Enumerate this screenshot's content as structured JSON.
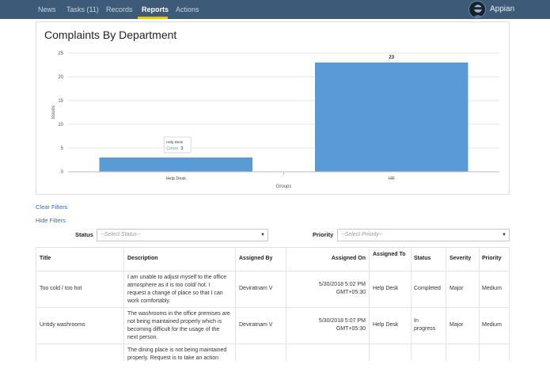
{
  "nav": {
    "items": [
      "News",
      "Tasks (11)",
      "Records",
      "Reports",
      "Actions"
    ],
    "active": "Reports",
    "brand": "Appian",
    "colors": {
      "bar": "#3d5a78",
      "active_underline": "#f0c400"
    }
  },
  "chart_card": {
    "title": "Complaints By Department"
  },
  "chart_data": {
    "type": "bar",
    "categories": [
      "Help Desk",
      "HR"
    ],
    "values": [
      3,
      23
    ],
    "xlabel": "Groups",
    "ylabel": "Issues",
    "ylim": [
      0,
      25
    ],
    "yticks": [
      0,
      5,
      10,
      15,
      20,
      25
    ],
    "data_labels": [
      "",
      "23"
    ],
    "tooltip": {
      "title": "Help Desk",
      "label": "Count",
      "value": "3"
    },
    "bar_color": "#5b9bd5",
    "grid": true
  },
  "filters": {
    "clear_link": "Clear Filters",
    "hide_link": "Hide Filters",
    "status_label": "Status",
    "status_placeholder": "--Select Status--",
    "priority_label": "Priority",
    "priority_placeholder": "--Select Priority--"
  },
  "table": {
    "headers": [
      "Title",
      "Description",
      "Assigned By",
      "Assigned On",
      "Assigned To",
      "Status",
      "Severity",
      "Priority"
    ],
    "rows": [
      {
        "title": "Too cold / too hot",
        "description": [
          "I am unable to adjust myself to the office",
          "atmosphere as it is too cold/ hot. I",
          "request a change of place so that I can",
          "work comfortably."
        ],
        "assigned_by": "Deviratnam V",
        "assigned_on": [
          "5/30/2018 5:02 PM",
          "GMT+05:30"
        ],
        "assigned_to": "Help Desk",
        "status": [
          "Completed"
        ],
        "severity": "Major",
        "priority": "Medium"
      },
      {
        "title": "Untidy washrooms",
        "description": [
          "The washrooms in the office premises are",
          "not being maintained properly which is",
          "becoming difficult for the usage of the",
          "next person."
        ],
        "assigned_by": "Deviratnam V",
        "assigned_on": [
          "5/30/2018 5:07 PM",
          "GMT+05:30"
        ],
        "assigned_to": "Help Desk",
        "status": [
          "In",
          "progress"
        ],
        "severity": "Major",
        "priority": "Medium"
      },
      {
        "description": [
          "The dining place is not being maintained",
          "properly. Request is to take an action"
        ]
      }
    ]
  }
}
